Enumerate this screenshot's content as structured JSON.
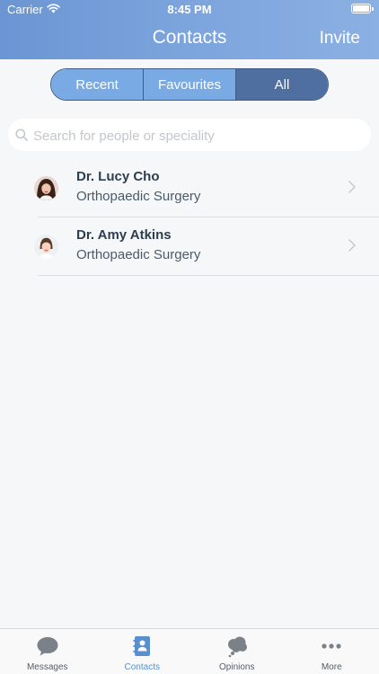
{
  "status_bar": {
    "carrier": "Carrier",
    "time": "8:45 PM"
  },
  "nav": {
    "title": "Contacts",
    "action": "Invite"
  },
  "segments": [
    {
      "label": "Recent",
      "active": false
    },
    {
      "label": "Favourites",
      "active": false
    },
    {
      "label": "All",
      "active": true
    }
  ],
  "search": {
    "placeholder": "Search for people or speciality",
    "value": ""
  },
  "contacts": [
    {
      "name": "Dr. Lucy Cho",
      "speciality": "Orthopaedic Surgery"
    },
    {
      "name": "Dr. Amy Atkins",
      "speciality": "Orthopaedic Surgery"
    }
  ],
  "tabbar": [
    {
      "label": "Messages",
      "icon": "messages-icon",
      "active": false
    },
    {
      "label": "Contacts",
      "icon": "contacts-icon",
      "active": true
    },
    {
      "label": "Opinions",
      "icon": "opinions-icon",
      "active": false
    },
    {
      "label": "More",
      "icon": "more-icon",
      "active": false
    }
  ],
  "colors": {
    "header_start": "#6b96d3",
    "header_end": "#8bb0e3",
    "segment_active": "#4f6fa1",
    "segment_inactive": "#7aaae4",
    "tab_active": "#5a8fcf",
    "tab_inactive": "#7b8188"
  }
}
